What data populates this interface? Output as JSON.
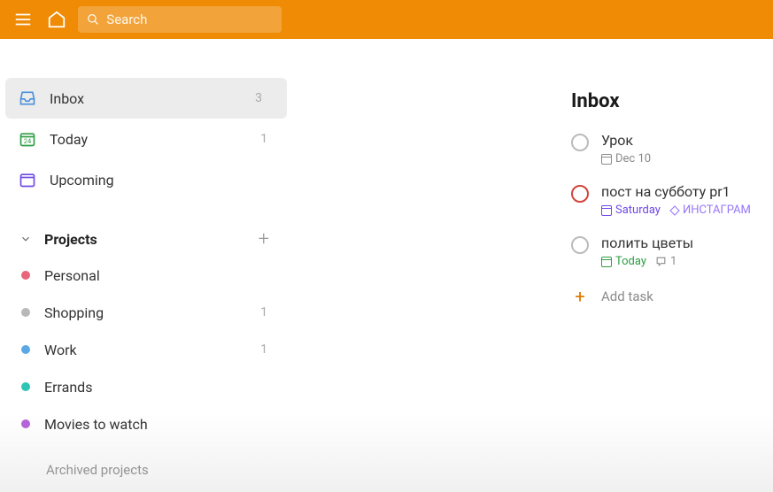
{
  "search": {
    "placeholder": "Search"
  },
  "sidebar": {
    "nav": [
      {
        "label": "Inbox",
        "count": "3",
        "icon": "inbox",
        "selected": true
      },
      {
        "label": "Today",
        "count": "1",
        "icon": "calendar-today",
        "selected": false
      },
      {
        "label": "Upcoming",
        "count": "",
        "icon": "calendar-upcoming",
        "selected": false
      }
    ],
    "projects_header": "Projects",
    "projects": [
      {
        "label": "Personal",
        "color": "#e8657a",
        "count": ""
      },
      {
        "label": "Shopping",
        "color": "#b8b8b8",
        "count": "1"
      },
      {
        "label": "Work",
        "color": "#5aa9e6",
        "count": "1"
      },
      {
        "label": "Errands",
        "color": "#2ec4b6",
        "count": ""
      },
      {
        "label": "Movies to watch",
        "color": "#b565d8",
        "count": ""
      }
    ],
    "archived_label": "Archived projects"
  },
  "main": {
    "title": "Inbox",
    "tasks": [
      {
        "title": "Урок",
        "priority": "none",
        "date": "Dec 10",
        "date_color": "gray",
        "tag": "",
        "comments": ""
      },
      {
        "title": "пост на субботу pr1",
        "priority": "red",
        "date": "Saturday",
        "date_color": "purple",
        "tag": "ИНСТАГРАМ",
        "comments": ""
      },
      {
        "title": "полить цветы",
        "priority": "none",
        "date": "Today",
        "date_color": "green",
        "tag": "",
        "comments": "1"
      }
    ],
    "add_task_label": "Add task"
  }
}
